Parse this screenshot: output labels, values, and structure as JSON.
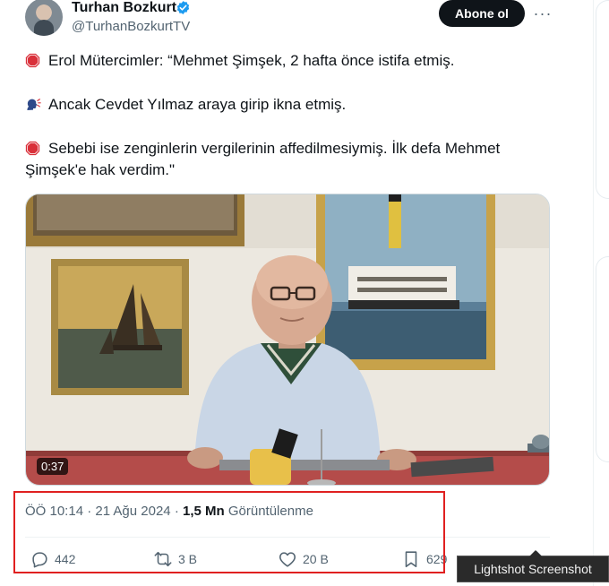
{
  "author": {
    "display_name": "Turhan Bozkurt",
    "handle": "@TurhanBozkurtTV",
    "verified": true,
    "follow_label": "Abone ol",
    "more_label": "···"
  },
  "tweet": {
    "line1": "Erol Mütercimler: “Mehmet Şimşek, 2 hafta önce istifa etmiş.",
    "line2": "Ancak Cevdet Yılmaz araya girip ikna etmiş.",
    "line3a": "Sebebi ise zenginlerin vergilerinin affedilmesiymiş. İlk defa Mehmet",
    "line3b": "Şimşek'e hak verdim.\"",
    "icons": [
      "stop-sign-icon",
      "speaking-head-icon",
      "stop-sign-icon"
    ]
  },
  "media": {
    "duration": "0:37"
  },
  "meta": {
    "time": "ÖÖ 10:14",
    "separator": "·",
    "date": "21 Ağu 2024",
    "views_count": "1,5 Mn",
    "views_label": "Görüntülenme"
  },
  "actions": {
    "replies": "442",
    "reposts": "3 B",
    "likes": "20 B",
    "bookmarks": "629"
  },
  "overlay": {
    "tooltip": "Lightshot Screenshot"
  },
  "colors": {
    "text_primary": "#0f1419",
    "text_secondary": "#536471",
    "verified_blue": "#1d9bf0",
    "highlight_red": "#e02020",
    "stop_red": "#d9303a"
  }
}
